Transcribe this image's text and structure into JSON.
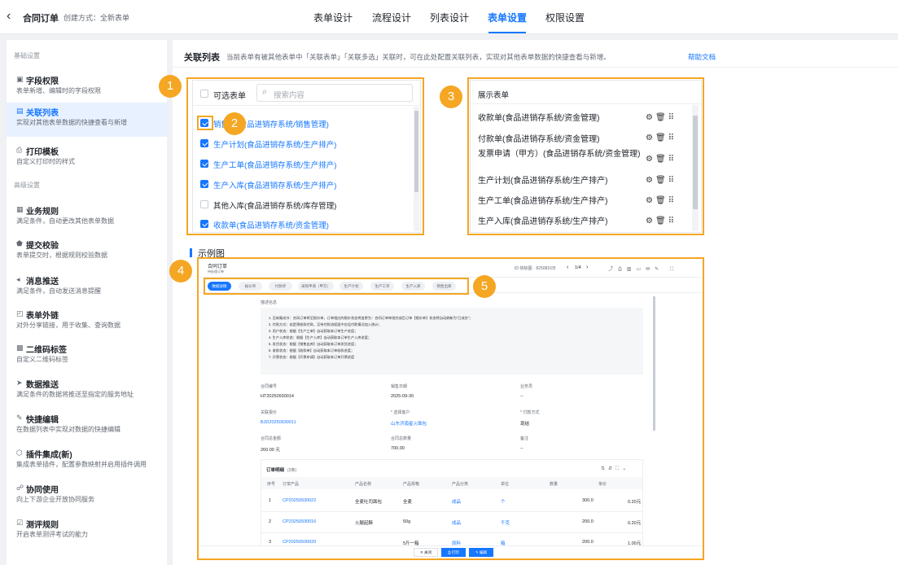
{
  "header": {
    "back_icon": "chevron-left-icon",
    "title": "合同订单",
    "subtitle": "创建方式：全新表单",
    "tabs": [
      "表单设计",
      "流程设计",
      "列表设计",
      "表单设置",
      "权限设置"
    ],
    "active_tab": "表单设置"
  },
  "sidebar": {
    "section_basic": "基础设置",
    "section_advanced": "高级设置",
    "items": [
      {
        "icon": "field-permission-icon",
        "label": "字段权限",
        "desc": "表单新增、编辑时的字段权限"
      },
      {
        "icon": "linked-list-icon",
        "label": "关联列表",
        "desc": "实现对其他表单数据的快捷查看与新增"
      },
      {
        "icon": "printer-icon",
        "label": "打印模板",
        "desc": "自定义打印时的样式"
      },
      {
        "icon": "rule-icon",
        "label": "业务规则",
        "desc": "满足条件，自动更改其他表单数据"
      },
      {
        "icon": "shield-icon",
        "label": "提交校验",
        "desc": "表单提交时，根据规则校验数据"
      },
      {
        "icon": "megaphone-icon",
        "label": "消息推送",
        "desc": "满足条件，自动发送消息提醒"
      },
      {
        "icon": "external-link-icon",
        "label": "表单外链",
        "desc": "对外分享链接，用于收集、查询数据"
      },
      {
        "icon": "qrcode-icon",
        "label": "二维码标签",
        "desc": "自定义二维码标签"
      },
      {
        "icon": "send-icon",
        "label": "数据推送",
        "desc": "满足条件的数据将推送至指定的服务地址"
      },
      {
        "icon": "edit-icon",
        "label": "快捷编辑",
        "desc": "在数据列表中实现对数据的快捷编辑"
      },
      {
        "icon": "plugin-icon",
        "label": "插件集成(新)",
        "desc": "集成表单插件，配置参数映射并启用插件调用"
      },
      {
        "icon": "team-icon",
        "label": "协同使用",
        "desc": "向上下游企业开放协同服务"
      },
      {
        "icon": "test-icon",
        "label": "测评规则",
        "desc": "开启表单测评考试的能力"
      }
    ]
  },
  "main": {
    "title": "关联列表",
    "desc": "当前表单有被其他表单中「关联表单」「关联多选」关联时，可在此处配置关联列表，实现对其他表单数据的快捷查看与新增。",
    "help": "帮助文档",
    "available": {
      "header": "可选表单",
      "search_placeholder": "搜索内容",
      "search_icon": "search-icon",
      "options": [
        {
          "label": "销售单(食品进销存系统/销售管理)",
          "checked": true
        },
        {
          "label": "生产计划(食品进销存系统/生产排产)",
          "checked": true
        },
        {
          "label": "生产工单(食品进销存系统/生产排产)",
          "checked": true
        },
        {
          "label": "生产入库(食品进销存系统/生产排产)",
          "checked": true
        },
        {
          "label": "其他入库(食品进销存系统/库存管理)",
          "checked": false
        },
        {
          "label": "收款单(食品进销存系统/资金管理)",
          "checked": true
        }
      ]
    },
    "display": {
      "header": "展示表单",
      "items": [
        "收款单(食品进销存系统/资金管理)",
        "付款单(食品进销存系统/资金管理)",
        "发票申请（甲方）(食品进销存系统/资金管理)",
        "生产计划(食品进销存系统/生产排产)",
        "生产工单(食品进销存系统/生产排产)",
        "生产入库(食品进销存系统/生产排产)"
      ],
      "item_icons": [
        "gear-icon",
        "trash-icon",
        "drag-handle-icon"
      ]
    },
    "example_title": "示例图",
    "badges": [
      "1",
      "2",
      "3",
      "4",
      "5"
    ]
  },
  "example": {
    "form_title": "合同订单",
    "form_sub": "待处理订单",
    "record_no": "ID 快标图：8250816日",
    "pager": "1/4",
    "steps": [
      "数据详情",
      "报价单",
      "付款单",
      "采购申请（甲方）",
      "生产计划",
      "生产工单",
      "生产入库",
      "销售出库"
    ],
    "desc_label": "描述信息",
    "desc_lines": [
      "1. 至新集成节：合同订单将至报价单，订单相应的报价状态将变更为：合同订单审批完成后订单【报价单】状态将自动刷新为\"已成交\"；",
      "2. 付款方式：若是预收款付款，至待付款流程面中应设付款情况加入统计；",
      "3. 用户状态：根据【生产工单】自动获取本订单生产进度；",
      "4. 生产入库状态：根据【生产入库】自动获取本订单生产入库进度；",
      "5. 发货状态：根据【销售出库】自动获取本订单发货进度；",
      "6. 收款状态：根据【收款单】自动获取本订单收款进度；",
      "7. 开票状态：根据【开票申请】自动获取本订单开票进度"
    ],
    "fields": [
      {
        "label": "合同编号",
        "value": "HT20250930014"
      },
      {
        "label": "销售日期",
        "value": "2025-09-30"
      },
      {
        "label": "业务员",
        "value": "--"
      },
      {
        "label": "关联报价",
        "value": "BJD20250930011",
        "link": true
      },
      {
        "label": "* 选择客户",
        "value": "山东济南星火面包",
        "link": true
      },
      {
        "label": "* 付款方式",
        "value": "现结"
      },
      {
        "label": "合同总金额",
        "value": "260.00 元"
      },
      {
        "label": "合同总数量",
        "value": "700.00"
      },
      {
        "label": "备注",
        "value": "--"
      }
    ],
    "table_title": "订单明细",
    "table_count": "(3条)",
    "table_headers": [
      "序号",
      "订单产品",
      "产品名称",
      "产品规格",
      "产品分类",
      "单位",
      "数量",
      "单价"
    ],
    "rows": [
      [
        "1",
        "CP20250930022",
        "全麦吐司面包",
        "全麦",
        "成品",
        "个",
        "300.0",
        "0.20元"
      ],
      [
        "2",
        "CP20250930016",
        "火腿起酥",
        "50g",
        "成品",
        "千克",
        "200.0",
        "0.20元"
      ],
      [
        "3",
        "CP20250930020",
        "",
        "5斤一箱",
        "原料",
        "箱",
        "200.0",
        "1.00元"
      ]
    ],
    "btn_close": "关闭",
    "btn_print": "打印",
    "btn_edit": "编辑"
  }
}
